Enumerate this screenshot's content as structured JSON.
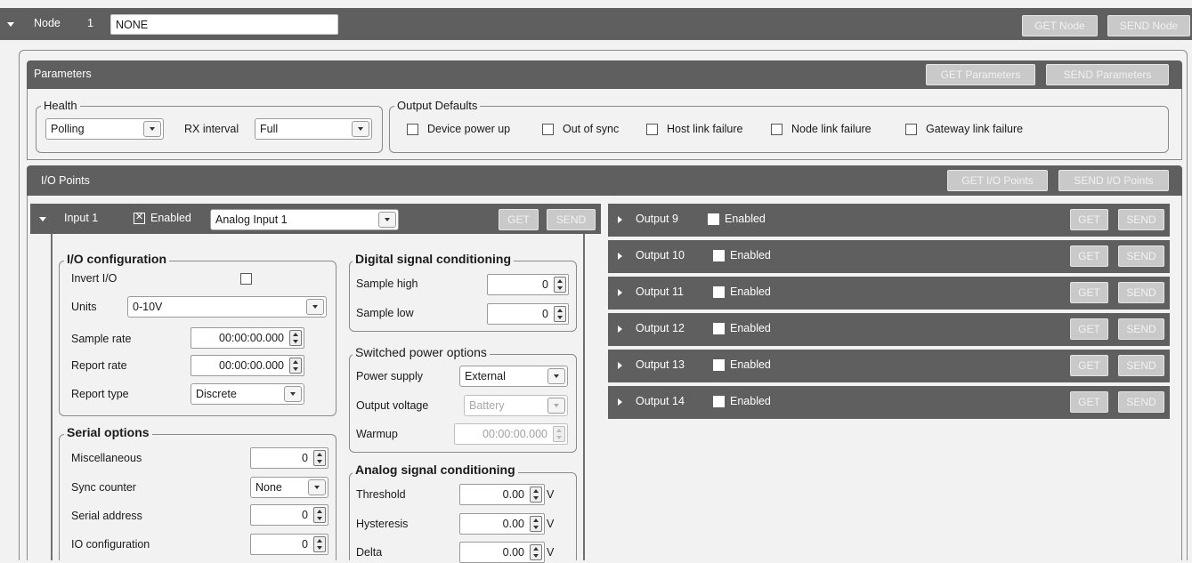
{
  "node": {
    "label": "Node",
    "number": "1",
    "name_value": "NONE",
    "get_button": "GET Node",
    "send_button": "SEND Node"
  },
  "parameters": {
    "title": "Parameters",
    "get_button": "GET Parameters",
    "send_button": "SEND Parameters",
    "health": {
      "legend": "Health",
      "mode_value": "Polling",
      "rx_interval_label": "RX interval",
      "rx_interval_value": "Full"
    },
    "output_defaults": {
      "legend": "Output Defaults",
      "options": [
        {
          "label": "Device power up",
          "checked": false
        },
        {
          "label": "Out of sync",
          "checked": false
        },
        {
          "label": "Host link failure",
          "checked": false
        },
        {
          "label": "Node link failure",
          "checked": false
        },
        {
          "label": "Gateway link failure",
          "checked": false
        }
      ]
    }
  },
  "io_points": {
    "title": "I/O Points",
    "get_button": "GET I/O Points",
    "send_button": "SEND I/O Points"
  },
  "input1": {
    "label": "Input 1",
    "enabled_label": "Enabled",
    "enabled": true,
    "type_value": "Analog Input 1",
    "get_button": "GET",
    "send_button": "SEND",
    "io_config": {
      "legend": "I/O configuration",
      "invert_label": "Invert I/O",
      "units_label": "Units",
      "units_value": "0-10V",
      "sample_rate_label": "Sample rate",
      "sample_rate_value": "00:00:00.000",
      "report_rate_label": "Report rate",
      "report_rate_value": "00:00:00.000",
      "report_type_label": "Report type",
      "report_type_value": "Discrete"
    },
    "serial": {
      "legend": "Serial options",
      "misc_label": "Miscellaneous",
      "misc_value": "0",
      "sync_label": "Sync counter",
      "sync_value": "None",
      "address_label": "Serial address",
      "address_value": "0",
      "ioconf_label": "IO configuration",
      "ioconf_value": "0"
    },
    "digital": {
      "legend": "Digital signal conditioning",
      "high_label": "Sample high",
      "high_value": "0",
      "low_label": "Sample low",
      "low_value": "0"
    },
    "power": {
      "legend": "Switched power options",
      "supply_label": "Power supply",
      "supply_value": "External",
      "voltage_label": "Output voltage",
      "voltage_value": "Battery",
      "warmup_label": "Warmup",
      "warmup_value": "00:00:00.000"
    },
    "analog": {
      "legend": "Analog signal conditioning",
      "threshold_label": "Threshold",
      "threshold_value": "0.00",
      "hysteresis_label": "Hysteresis",
      "hysteresis_value": "0.00",
      "delta_label": "Delta",
      "delta_value": "0.00",
      "unit": "V"
    }
  },
  "outputs": [
    {
      "label": "Output 9",
      "enabled_label": "Enabled",
      "get": "GET",
      "send": "SEND"
    },
    {
      "label": "Output 10",
      "enabled_label": "Enabled",
      "get": "GET",
      "send": "SEND"
    },
    {
      "label": "Output 11",
      "enabled_label": "Enabled",
      "get": "GET",
      "send": "SEND"
    },
    {
      "label": "Output 12",
      "enabled_label": "Enabled",
      "get": "GET",
      "send": "SEND"
    },
    {
      "label": "Output 13",
      "enabled_label": "Enabled",
      "get": "GET",
      "send": "SEND"
    },
    {
      "label": "Output 14",
      "enabled_label": "Enabled",
      "get": "GET",
      "send": "SEND"
    }
  ],
  "colors": {
    "bar": "#5f5f5f",
    "background": "#f2f2f2",
    "button": "#c9c9c9"
  }
}
